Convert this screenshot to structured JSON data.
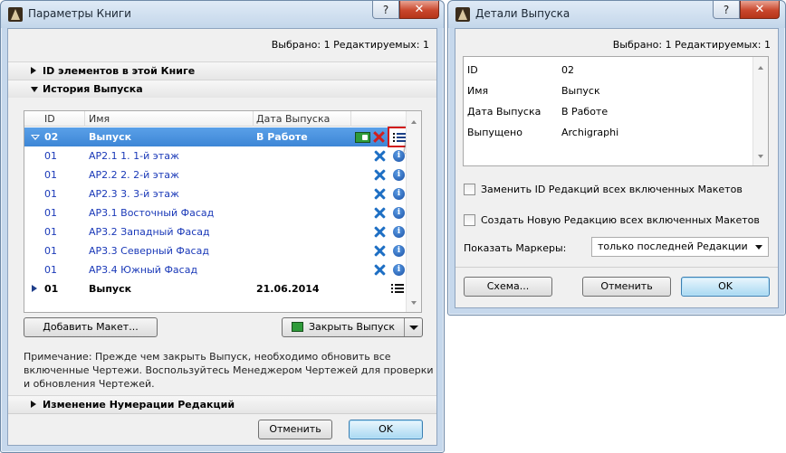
{
  "book_window": {
    "title": "Параметры Книги",
    "help_label": "?",
    "close_label": "✕",
    "status": "Выбрано: 1 Редактируемых: 1",
    "sections": {
      "ids": "ID элементов в этой Книге",
      "history": "История Выпуска",
      "renumber": "Изменение Нумерации Редакций"
    },
    "table": {
      "columns": [
        "ID",
        "Имя",
        "Дата Выпуска"
      ],
      "rows": [
        {
          "id": "02",
          "name": "Выпуск",
          "date": "В Работе",
          "kind": "release-selected"
        },
        {
          "id": "01",
          "name": "АР2.1 1. 1-й этаж",
          "kind": "child"
        },
        {
          "id": "01",
          "name": "АР2.2 2. 2-й этаж",
          "kind": "child"
        },
        {
          "id": "01",
          "name": "АР2.3 3. 3-й этаж",
          "kind": "child"
        },
        {
          "id": "01",
          "name": "АР3.1 Восточный Фасад",
          "kind": "child"
        },
        {
          "id": "01",
          "name": "АР3.2 Западный Фасад",
          "kind": "child"
        },
        {
          "id": "01",
          "name": "АР3.3 Северный Фасад",
          "kind": "child"
        },
        {
          "id": "01",
          "name": "АР3.4 Южный Фасад",
          "kind": "child"
        },
        {
          "id": "01",
          "name": "Выпуск",
          "date": "21.06.2014",
          "kind": "release"
        }
      ],
      "info_glyph": "i"
    },
    "buttons": {
      "add_layout": "Добавить Макет...",
      "close_release": "Закрыть Выпуск",
      "cancel": "Отменить",
      "ok": "OK"
    },
    "note": "Примечание: Прежде чем закрыть Выпуск, необходимо обновить все включенные Чертежи. Воспользуйтесь Менеджером Чертежей для проверки и обновления Чертежей."
  },
  "details_window": {
    "title": "Детали Выпуска",
    "help_label": "?",
    "close_label": "✕",
    "status": "Выбрано: 1 Редактируемых: 1",
    "props": [
      {
        "key": "ID",
        "value": "02"
      },
      {
        "key": "Имя",
        "value": "Выпуск"
      },
      {
        "key": "Дата Выпуска",
        "value": "В Работе"
      },
      {
        "key": "Выпущено",
        "value": "Archigraphi"
      }
    ],
    "replace_id_label": "Заменить ID Редакций всех включенных Макетов",
    "create_revision_label": "Создать Новую Редакцию всех включенных Макетов",
    "markers_label": "Показать Маркеры:",
    "markers_value": "только последней Редакции",
    "buttons": {
      "schema": "Схема...",
      "cancel": "Отменить",
      "ok": "OK"
    }
  },
  "colors": {
    "selection": "#3d86d6",
    "child_text": "#1a39b8",
    "highlight": "#d11b1b",
    "frame": "#c6d8ec"
  },
  "icons": [
    "app-icon",
    "help-icon",
    "close-icon",
    "delete-icon",
    "info-icon",
    "list-icon",
    "release-status-icon",
    "dropdown-icon"
  ]
}
